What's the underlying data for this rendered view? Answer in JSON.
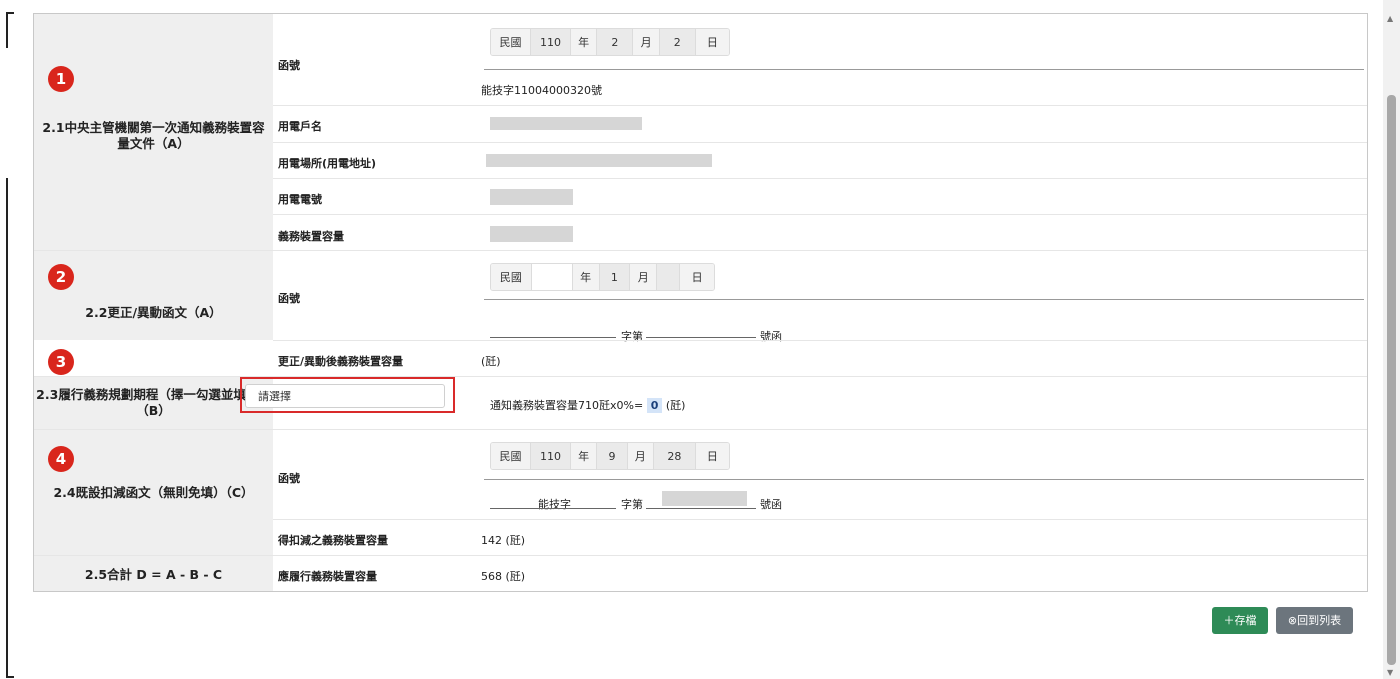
{
  "sections": [
    {
      "number": "1",
      "title": "2.1中央主管機關第一次通知義務裝置容量文件（A）"
    },
    {
      "number": "2",
      "title": "2.2更正/異動函文（A）"
    },
    {
      "number": "3",
      "title": "2.3履行義務規劃期程（擇一勾選並填列）（B）"
    },
    {
      "number": "4",
      "title": "2.4既設扣減函文（無則免填）（C）"
    },
    {
      "number": "",
      "title": "2.5合計 D = A - B - C"
    }
  ],
  "date_labels": {
    "era": "民國",
    "year": "年",
    "month": "月",
    "day": "日"
  },
  "s1": {
    "letter_label": "函號",
    "date": {
      "year": "110",
      "month": "2",
      "day": "2"
    },
    "letter_number": "能技字11004000320號",
    "customer_label": "用電戶名",
    "address_label": "用電場所(用電地址)",
    "phone_label": "用電電號",
    "capacity_label": "義務裝置容量"
  },
  "s2": {
    "letter_label": "函號",
    "date": {
      "year": "",
      "month": "1",
      "day": ""
    },
    "word_label": "字第",
    "number_label": "號函",
    "after_label": "更正/異動後義務裝置容量",
    "after_value": "(瓩)"
  },
  "s3": {
    "select_placeholder": "請選擇",
    "formula_prefix": "通知義務裝置容量710瓩x0%=",
    "formula_value": "0",
    "formula_unit": "(瓩)"
  },
  "s4": {
    "letter_label": "函號",
    "date": {
      "year": "110",
      "month": "9",
      "day": "28"
    },
    "word_prefix": "能技字",
    "word_label": "字第",
    "number_label": "號函",
    "deduct_label": "得扣減之義務裝置容量",
    "deduct_value": "142 (瓩)"
  },
  "s5": {
    "total_label": "應履行義務裝置容量",
    "total_value": "568 (瓩)"
  },
  "buttons": {
    "save": "＋存檔",
    "back": "⊗回到列表"
  },
  "colors": {
    "badge": "#d9261c",
    "save": "#2e8b57",
    "back": "#6c757d",
    "highlight": "#d92a2a"
  }
}
